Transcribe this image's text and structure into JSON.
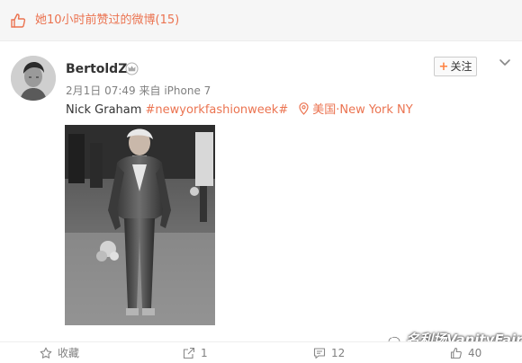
{
  "like_notice": {
    "text": "她10小时前赞过的微博(15)"
  },
  "post": {
    "username": "BertoldZ",
    "time": "2月1日 07:49",
    "source_prefix": "来自",
    "source": "iPhone 7",
    "text": "Nick Graham ",
    "hashtag": "#newyorkfashionweek#",
    "location": "美国·New York NY",
    "follow_label": "关注"
  },
  "footer": {
    "favorite_label": "收藏",
    "share_count": "1",
    "comment_count": "12",
    "like_count": "40"
  },
  "watermark": {
    "text": "名利场VanityFair"
  },
  "colors": {
    "accent": "#eb7350",
    "muted": "#808080",
    "follow_plus": "#ff8140"
  },
  "icons": [
    "thumbs-up-icon",
    "crown-icon",
    "chevron-down-icon",
    "location-pin-icon",
    "star-icon",
    "share-icon",
    "comment-icon",
    "wechat-icon"
  ]
}
